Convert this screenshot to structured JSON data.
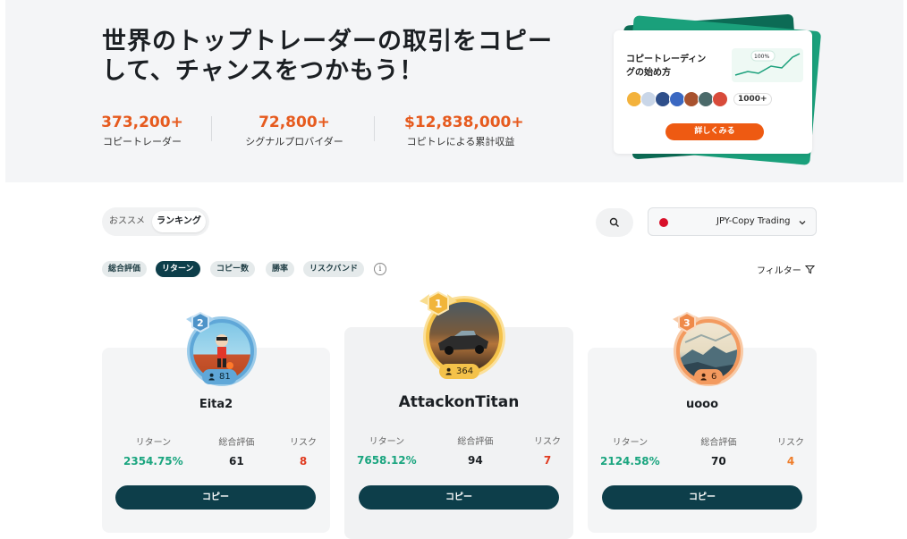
{
  "hero": {
    "title": "世界のトップトレーダーの取引をコピーして、チャンスをつかもう！",
    "stats": [
      {
        "value": "373,200+",
        "label": "コピートレーダー"
      },
      {
        "value": "72,800+",
        "label": "シグナルプロバイダー"
      },
      {
        "value": "$12,838,000+",
        "label": "コピトレによる累計収益"
      }
    ],
    "promo": {
      "title": "コピートレーディングの始め方",
      "chart_badge": "100%",
      "avatar_count": "1000+",
      "button": "詳しくみる"
    }
  },
  "controls": {
    "tabs": [
      "おススメ",
      "ランキング"
    ],
    "selected_tab": "ランキング",
    "account_select": "JPY-Copy Trading",
    "chips": [
      "総合評価",
      "リターン",
      "コピー数",
      "勝率",
      "リスクバンド"
    ],
    "active_chip": "リターン",
    "filter_label": "フィルター"
  },
  "metric_labels": {
    "return": "リターン",
    "score": "総合評価",
    "risk": "リスク"
  },
  "traders": [
    {
      "rank": "2",
      "name": "Eita2",
      "followers": "81",
      "return": "2354.75%",
      "score": "61",
      "risk": "8",
      "copy_label": "コピー"
    },
    {
      "rank": "1",
      "name": "AttackonTitan",
      "followers": "364",
      "return": "7658.12%",
      "score": "94",
      "risk": "7",
      "copy_label": "コピー"
    },
    {
      "rank": "3",
      "name": "uooo",
      "followers": "6",
      "return": "2124.58%",
      "score": "70",
      "risk": "4",
      "copy_label": "コピー"
    }
  ],
  "colors": {
    "accent_orange": "#e65b1f",
    "dark_teal": "#0d3e4a",
    "return_green": "#1aa57f",
    "risk_red": "#e03a1f",
    "risk_orange": "#ef7d2a"
  }
}
